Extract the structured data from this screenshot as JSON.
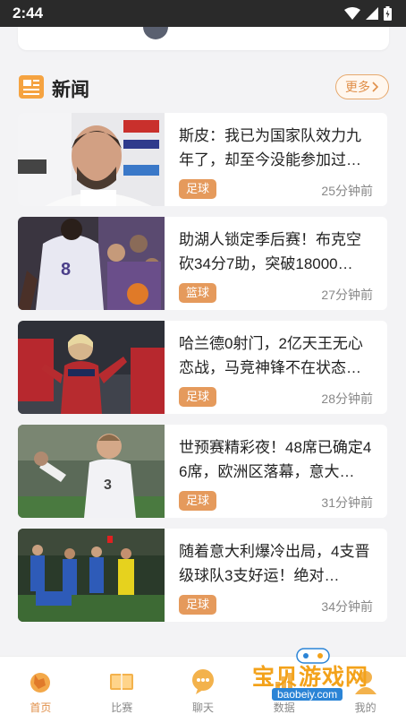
{
  "status_bar": {
    "time": "2:44"
  },
  "section": {
    "title": "新闻",
    "more_label": "更多"
  },
  "news": [
    {
      "title": "斯皮：我已为国家队效力九年了，却至今没能参加过…",
      "tag": "足球",
      "time": "25分钟前"
    },
    {
      "title": "助湖人锁定季后赛！布克空砍34分7助，突破18000…",
      "tag": "篮球",
      "time": "27分钟前"
    },
    {
      "title": "哈兰德0射门，2亿天王无心恋战，马竞神锋不在状态…",
      "tag": "足球",
      "time": "28分钟前"
    },
    {
      "title": "世预赛精彩夜！48席已确定46席，欧洲区落幕，意大…",
      "tag": "足球",
      "time": "31分钟前"
    },
    {
      "title": "随着意大利爆冷出局，4支晋级球队3支好运！绝对…",
      "tag": "足球",
      "time": "34分钟前"
    }
  ],
  "bottom_nav": [
    {
      "label": "首页",
      "icon": "home-icon",
      "active": true
    },
    {
      "label": "比赛",
      "icon": "match-icon",
      "active": false
    },
    {
      "label": "聊天",
      "icon": "chat-icon",
      "active": false
    },
    {
      "label": "数据",
      "icon": "data-icon",
      "active": false
    },
    {
      "label": "我的",
      "icon": "profile-icon",
      "active": false
    }
  ],
  "watermark": {
    "text": "宝贝游戏网",
    "url": "baobeiy.com"
  },
  "colors": {
    "accent": "#e08f49",
    "tag": "#e59a5c",
    "status_bar": "#2a2a2a"
  }
}
